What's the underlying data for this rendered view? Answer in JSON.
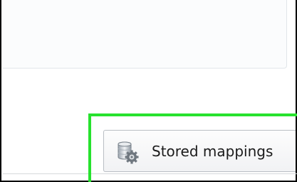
{
  "stored_mappings": {
    "label": "Stored mappings",
    "icon": "database-gear-icon"
  },
  "colors": {
    "highlight": "#27e22e",
    "frame": "#000000"
  }
}
